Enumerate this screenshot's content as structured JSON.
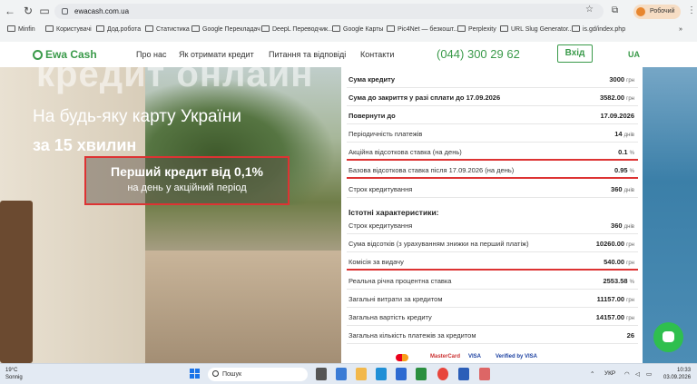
{
  "browser": {
    "url": "ewacash.com.ua",
    "profile_label": "Робочий",
    "bookmarks": [
      "Minfin",
      "Користувачі",
      "Дод.робота",
      "Статистика",
      "Google Перекладач",
      "DeepL Переводчик...",
      "Google Карты",
      "Pic4Net — безкошт...",
      "Perplexity",
      "URL Slug Generator...",
      "is.gd/index.php"
    ]
  },
  "header": {
    "logo": "Ewa Cash",
    "nav": [
      "Про нас",
      "Як отримати кредит",
      "Питання та відповіді",
      "Контакти"
    ],
    "phone": "(044) 300 29 62",
    "login": "Вхід",
    "lang": "UA"
  },
  "hero": {
    "big": "кредит онлайн",
    "line1": "На будь-яку карту України",
    "line2": "за 15 хвилин",
    "promo_title": "Перший кредит від 0,1%",
    "promo_sub": "на день у акційний період"
  },
  "loan": {
    "rows": [
      {
        "label": "Сума кредиту",
        "value": "3000",
        "unit": "грн"
      },
      {
        "label": "Сума до закриття у разі сплати до 17.09.2026",
        "value": "3582.00",
        "unit": "грн"
      },
      {
        "label": "Повернути до",
        "value": "17.09.2026",
        "unit": ""
      },
      {
        "label": "Періодичність платежів",
        "value": "14",
        "unit": "днів"
      },
      {
        "label": "Акційна відсоткова ставка (на день)",
        "value": "0.1",
        "unit": "%"
      },
      {
        "label": "Базова відсоткова ставка після 17.09.2026 (на день)",
        "value": "0.95",
        "unit": "%"
      },
      {
        "label": "Строк кредитування",
        "value": "360",
        "unit": "днів"
      }
    ],
    "section_title": "Істотні характеристики:",
    "rows2": [
      {
        "label": "Строк кредитування",
        "value": "360",
        "unit": "днів"
      },
      {
        "label": "Сума відсотків (з урахуванням знижки на перший платіж)",
        "value": "10260.00",
        "unit": "грн"
      },
      {
        "label": "Комісія за видачу",
        "value": "540.00",
        "unit": "грн"
      },
      {
        "label": "Реальна річна процентна ставка",
        "value": "2553.58",
        "unit": "%"
      },
      {
        "label": "Загальні витрати за кредитом",
        "value": "11157.00",
        "unit": "грн"
      },
      {
        "label": "Загальна вартість кредиту",
        "value": "14157.00",
        "unit": "грн"
      },
      {
        "label": "Загальна кількість платежів за кредитом",
        "value": "26",
        "unit": ""
      }
    ]
  },
  "payments": [
    "MasterCard",
    "VISA",
    "Verified by VISA"
  ],
  "taskbar": {
    "weather_temp": "19°C",
    "weather_desc": "Sonnig",
    "search": "Пошук",
    "lang": "УКР",
    "time": "10:33",
    "date": "03.09.2026"
  }
}
